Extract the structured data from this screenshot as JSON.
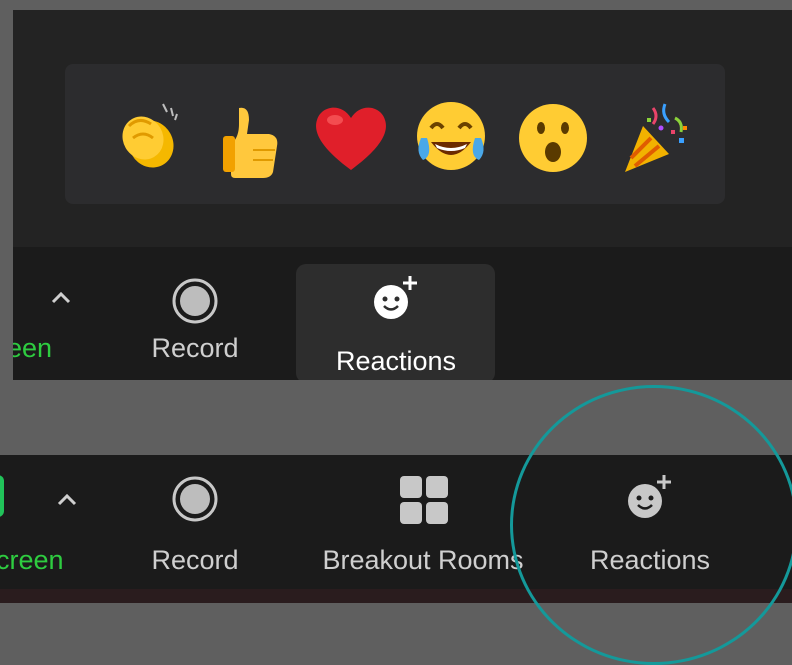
{
  "reactions_popup": {
    "emojis": [
      {
        "name": "clap"
      },
      {
        "name": "thumbs-up"
      },
      {
        "name": "heart"
      },
      {
        "name": "tears-of-joy"
      },
      {
        "name": "open-mouth"
      },
      {
        "name": "party-popper"
      }
    ]
  },
  "toolbar_top": {
    "share_label_partial": "een",
    "record_label": "Record",
    "reactions_label": "Reactions"
  },
  "toolbar_bottom": {
    "share_label_partial": "creen",
    "record_label": "Record",
    "breakout_label": "Breakout Rooms",
    "reactions_label": "Reactions"
  },
  "colors": {
    "share_green": "#2ecc40",
    "highlight_circle": "#14999a",
    "toolbar_bg": "#1b1b1b",
    "popup_bg": "#2c2c2e"
  }
}
